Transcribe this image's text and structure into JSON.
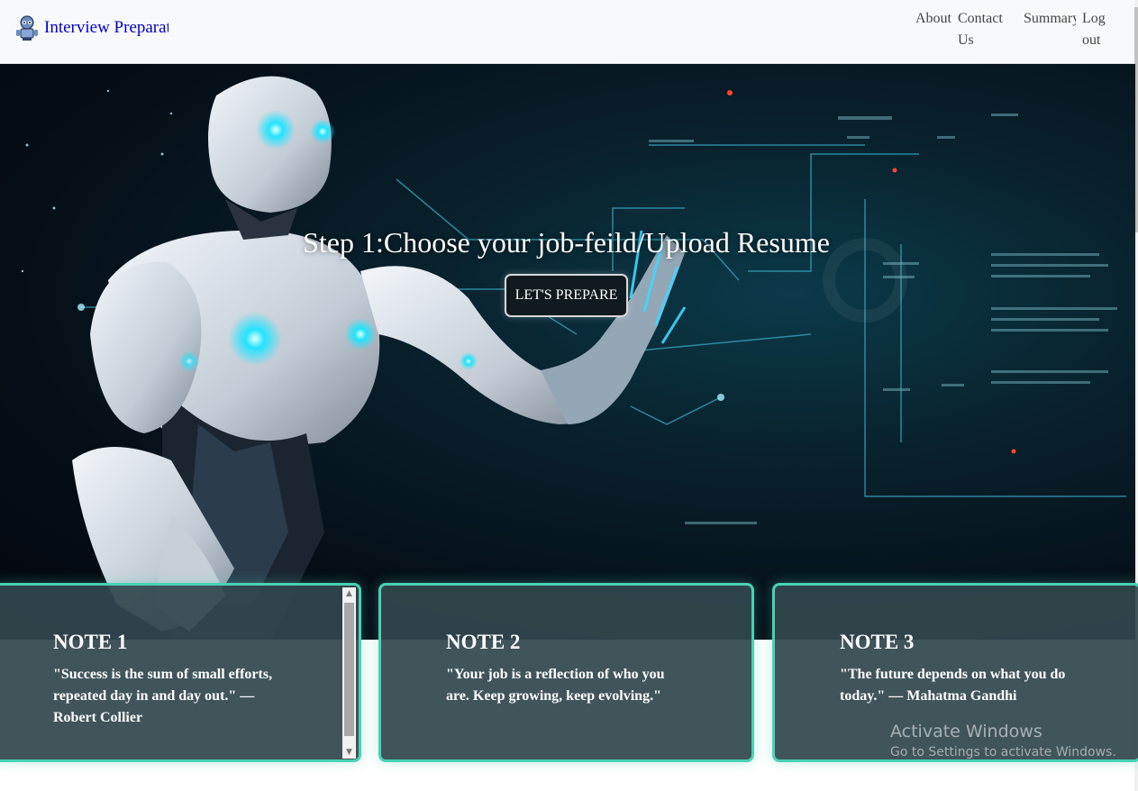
{
  "navbar": {
    "brand": "Interview Preparation",
    "links": {
      "about": "About",
      "contact": "Contact Us",
      "summary": "Summary",
      "logout": "Log out"
    }
  },
  "hero": {
    "title": "Step 1:Choose your job-feild/Upload Resume",
    "button": "LET'S PREPARE"
  },
  "notes": [
    {
      "title": "NOTE 1",
      "text": "\"Success is the sum of small efforts, repeated day in and day out.\" — Robert Collier"
    },
    {
      "title": "NOTE 2",
      "text": "\"Your job is a reflection of who you are. Keep growing, keep evolving.\""
    },
    {
      "title": "NOTE 3",
      "text": "\"The future depends on what you do today.\" — Mahatma Gandhi"
    }
  ],
  "watermark": {
    "title": "Activate Windows",
    "subtitle": "Go to Settings to activate Windows."
  },
  "colors": {
    "accent": "#4ad1b4",
    "brand_link": "#0000cc",
    "navbar_bg": "#f8f9fa"
  }
}
